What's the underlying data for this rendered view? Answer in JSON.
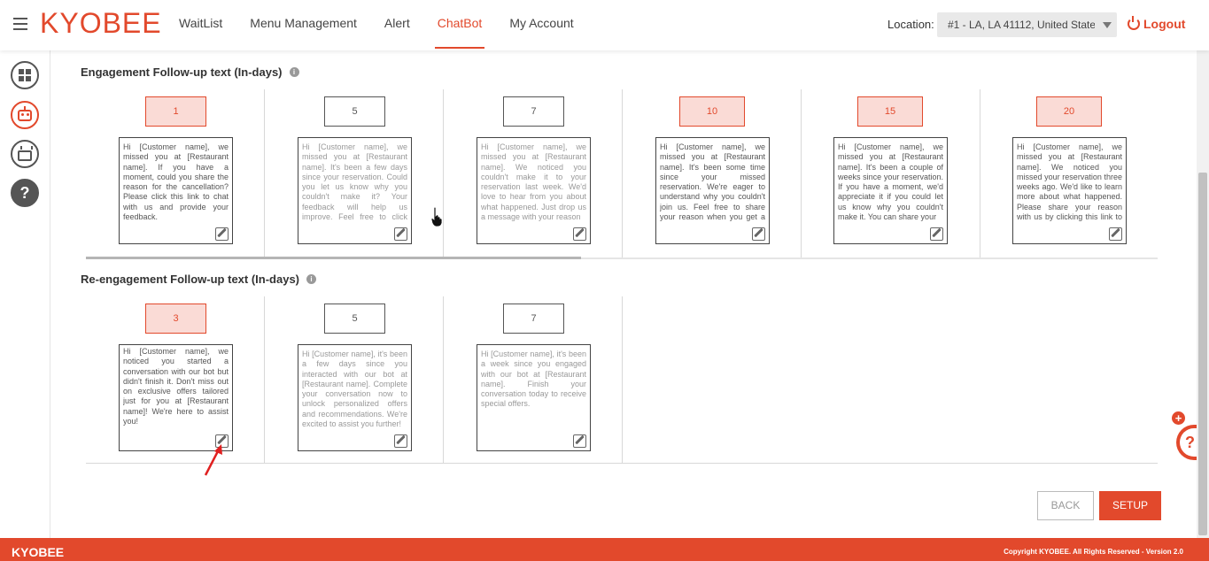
{
  "header": {
    "logo": "KYOBEE",
    "nav": [
      "WaitList",
      "Menu Management",
      "Alert",
      "ChatBot",
      "My Account"
    ],
    "active_nav": "ChatBot",
    "location_label": "Location:",
    "location_value": "#1 - LA, LA 41112, United States",
    "logout": "Logout"
  },
  "sidebar": {
    "icons": [
      "dashboard-icon",
      "chatbot-robot-icon",
      "cake-icon",
      "help-icon"
    ],
    "help_glyph": "?"
  },
  "engagement": {
    "title": "Engagement Follow-up text (In-days)",
    "info_glyph": "i",
    "items": [
      {
        "day": "1",
        "highlight": true,
        "text": "Hi [Customer name], we missed you at [Restaurant name]. If you have a moment, could you share the reason for the cancellation? Please click this link to chat with us and provide your feedback."
      },
      {
        "day": "5",
        "highlight": false,
        "text": "Hi [Customer name], we missed you at [Restaurant name]. It's been a few days since your reservation. Could you let us know why you couldn't make it? Your feedback will help us improve. Feel free to click this"
      },
      {
        "day": "7",
        "highlight": false,
        "text": "Hi [Customer name], we missed you at [Restaurant name]. We noticed you couldn't make it to your reservation last week. We'd love to hear from you about what happened. Just drop us a message with your reason"
      },
      {
        "day": "10",
        "highlight": true,
        "text": "Hi [Customer name], we missed you at [Restaurant name]. It's been some time since your missed reservation. We're eager to understand why you couldn't join us. Feel free to share your reason when you get a chance"
      },
      {
        "day": "15",
        "highlight": true,
        "text": "Hi [Customer name], we missed you at [Restaurant name]. It's been a couple of weeks since your reservation. If you have a moment, we'd appreciate it if you could let us know why you couldn't make it. You can share your"
      },
      {
        "day": "20",
        "highlight": true,
        "text": "Hi [Customer name], we missed you at [Restaurant name]. We noticed you missed your reservation three weeks ago. We'd like to learn more about what happened. Please share your reason with us by clicking this link to chat"
      }
    ]
  },
  "reengagement": {
    "title": "Re-engagement Follow-up text (In-days)",
    "info_glyph": "i",
    "items": [
      {
        "day": "3",
        "highlight": true,
        "text": "Hi [Customer name], we noticed you started a conversation with our bot but didn't finish it. Don't miss out on exclusive offers tailored just for you at [Restaurant name]! We're here to assist you!"
      },
      {
        "day": "5",
        "highlight": false,
        "text": "Hi [Customer name], it's been a few days since you interacted with our bot at [Restaurant name]. Complete your conversation now to unlock personalized offers and recommendations. We're excited to assist you further!"
      },
      {
        "day": "7",
        "highlight": false,
        "text": "Hi [Customer name], it's been a week since you engaged with our bot at [Restaurant name]. Finish your conversation today to receive special offers."
      }
    ]
  },
  "buttons": {
    "back": "BACK",
    "setup": "SETUP"
  },
  "footer": {
    "logo": "KYOBEE",
    "copyright": "Copyright KYOBEE. All Rights Reserved - Version 2.0"
  },
  "chat_widget": {
    "plus": "+",
    "glyph": "?"
  },
  "colors": {
    "accent": "#e2492c",
    "highlight_bg": "#fadbd6"
  }
}
